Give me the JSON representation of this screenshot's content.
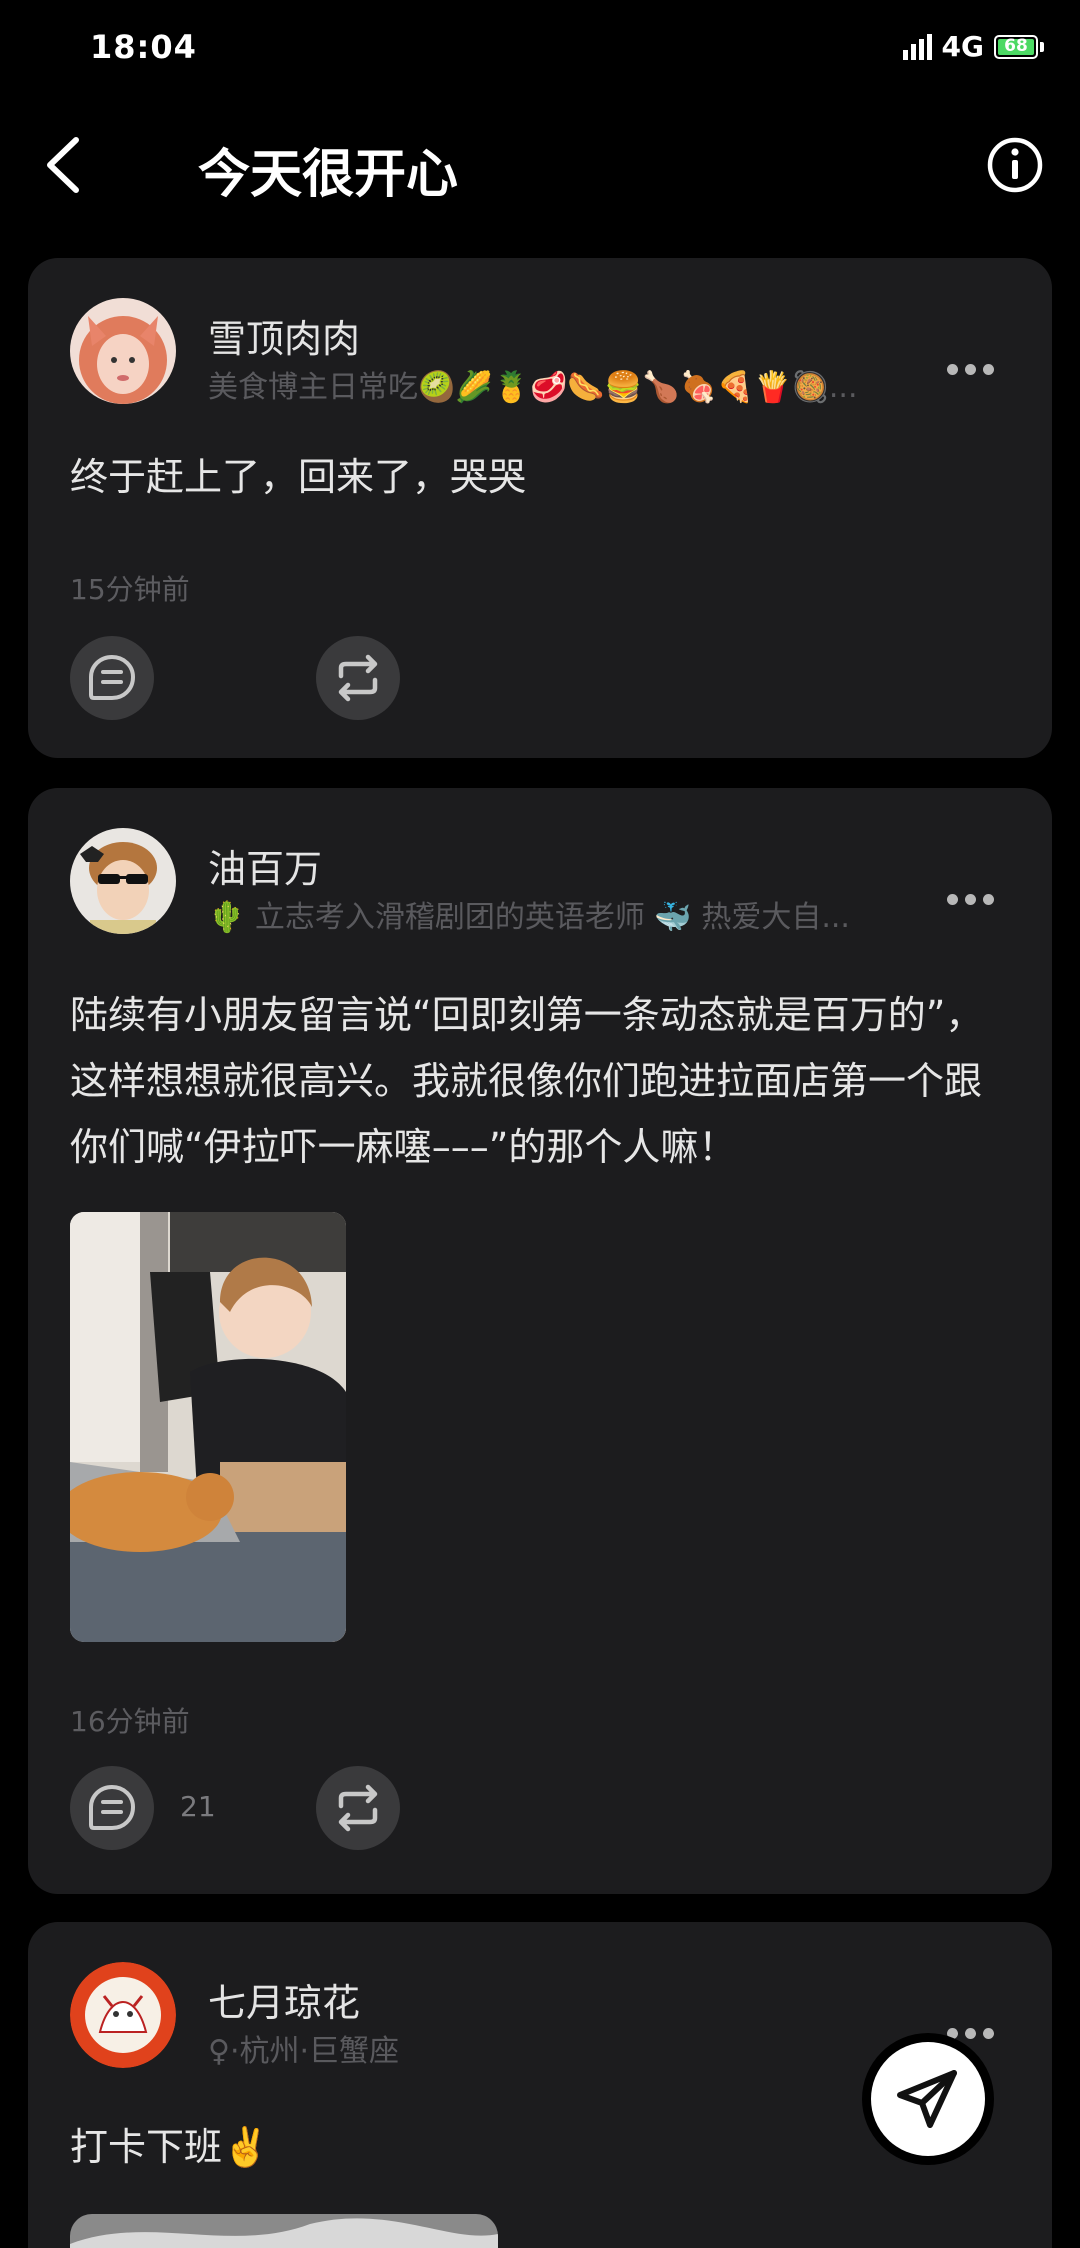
{
  "status_bar": {
    "time": "18:04",
    "network": "4G",
    "battery": "68"
  },
  "header": {
    "title": "今天很开心",
    "back_icon": "chevron-left-icon",
    "info_icon": "info-circle-icon"
  },
  "posts": [
    {
      "author": "雪顶肉肉",
      "bio": "美食博主日常吃🥝🌽🍍🥩🌭🍔🍗🍖🍕🍟🥘...",
      "text": "终于赶上了，回来了，哭哭",
      "time": "15分钟前",
      "comment_count": "",
      "comment_icon": "comment-icon",
      "repost_icon": "repost-icon"
    },
    {
      "author": "油百万",
      "bio": "🌵 立志考入滑稽剧团的英语老师 🐳 热爱大自...",
      "text": "陆续有小朋友留言说“回即刻第一条动态就是百万的”，这样想想就很高兴。我就很像你们跑进拉面店第一个跟你们喊“伊拉吓一麻噻–––”的那个人嘛！",
      "time": "16分钟前",
      "comment_count": "21",
      "comment_icon": "comment-icon",
      "repost_icon": "repost-icon"
    },
    {
      "author": "七月琼花",
      "bio": "♀·杭州·巨蟹座",
      "text": "打卡下班✌️",
      "time": "",
      "comment_count": ""
    }
  ],
  "fab": {
    "icon": "send-icon"
  },
  "colors": {
    "background": "#000000",
    "card": "#1c1c1e",
    "action_button": "#3a3a3c",
    "muted_text": "#5a5a5e",
    "battery": "#4cd964"
  }
}
